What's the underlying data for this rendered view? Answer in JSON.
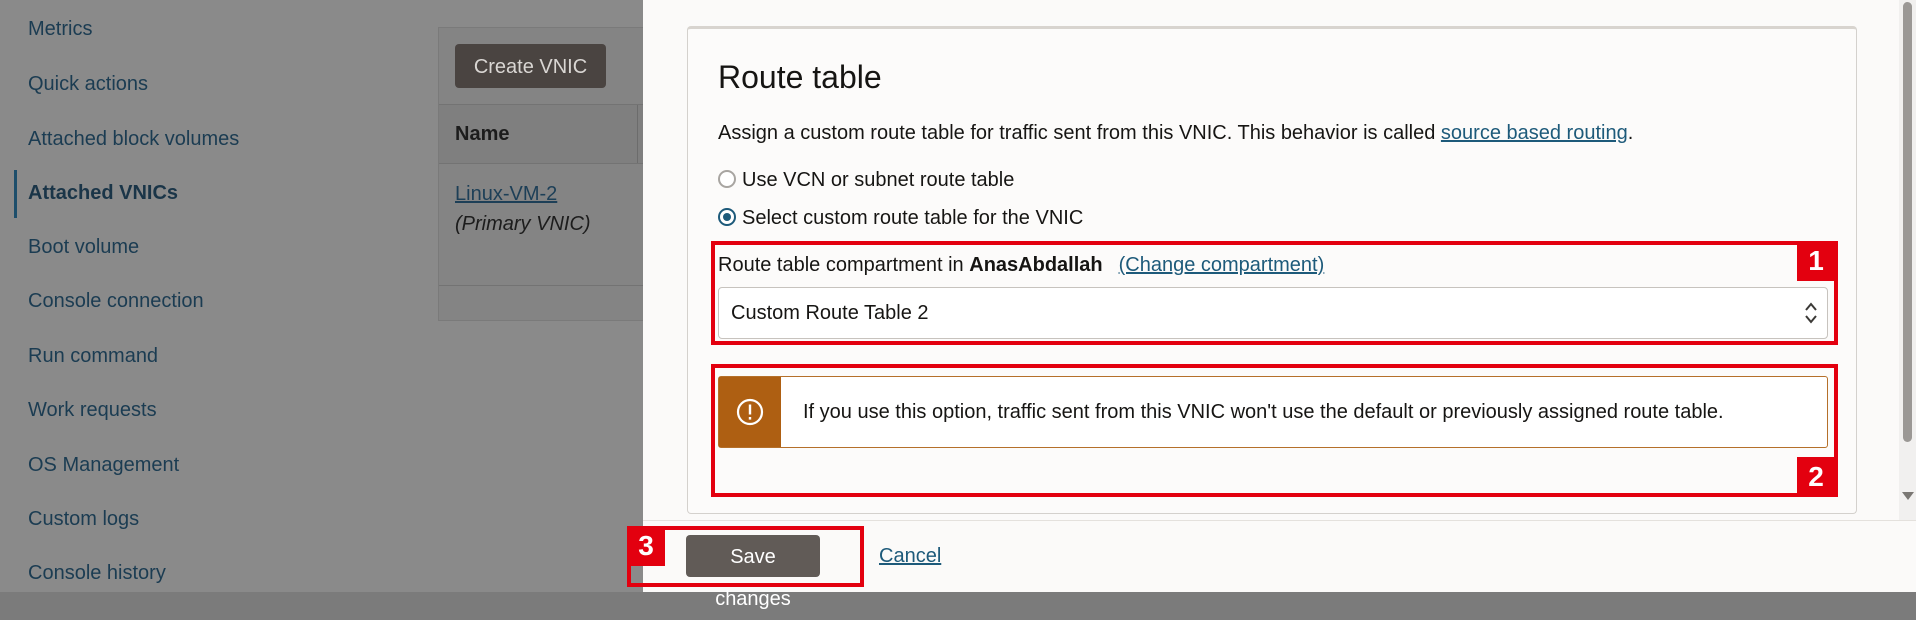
{
  "sidebar": {
    "items": [
      {
        "label": "Metrics",
        "active": false
      },
      {
        "label": "Quick actions",
        "active": false
      },
      {
        "label": "Attached block volumes",
        "active": false
      },
      {
        "label": "Attached VNICs",
        "active": true
      },
      {
        "label": "Boot volume",
        "active": false
      },
      {
        "label": "Console connection",
        "active": false
      },
      {
        "label": "Run command",
        "active": false
      },
      {
        "label": "Work requests",
        "active": false
      },
      {
        "label": "OS Management",
        "active": false
      },
      {
        "label": "Custom logs",
        "active": false
      },
      {
        "label": "Console history",
        "active": false
      }
    ]
  },
  "vnics": {
    "create_button": "Create VNIC",
    "columns": [
      "Name"
    ],
    "rows": [
      {
        "name": "Linux-VM-2",
        "note": "(Primary VNIC)"
      }
    ]
  },
  "route_table": {
    "title": "Route table",
    "description_prefix": "Assign a custom route table for traffic sent from this VNIC. This behavior is called ",
    "description_link": "source based routing",
    "description_suffix": ".",
    "options": [
      {
        "label": "Use VCN or subnet route table",
        "selected": false
      },
      {
        "label": "Select custom route table for the VNIC",
        "selected": true
      }
    ],
    "compartment_prefix": "Route table compartment in ",
    "compartment_name": "AnasAbdallah",
    "change_compartment": "(Change compartment)",
    "selected_route_table": "Custom Route Table 2",
    "warning": "If you use this option, traffic sent from this VNIC won't use the default or previously assigned route table."
  },
  "footer": {
    "save_label": "Save changes",
    "cancel_label": "Cancel"
  },
  "annotations": {
    "labels": [
      "1",
      "2",
      "3"
    ],
    "color": "#e3000f"
  },
  "colors": {
    "link": "#1d5a7a",
    "warning": "#ae5f12",
    "primary_button": "#615b57"
  }
}
